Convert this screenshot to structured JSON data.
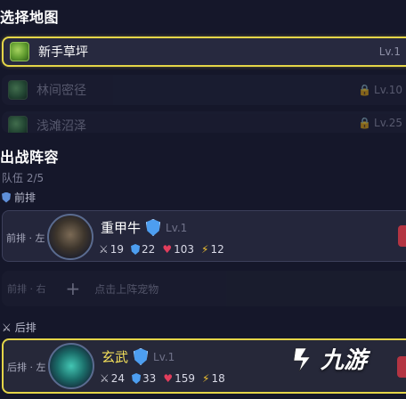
{
  "map_section": {
    "title": "选择地图",
    "maps": [
      {
        "name": "新手草坪",
        "level": "Lv.1",
        "locked": false,
        "selected": true
      },
      {
        "name": "林间密径",
        "level": "Lv.10",
        "locked": true,
        "selected": false
      },
      {
        "name": "浅滩沼泽",
        "level": "Lv.25",
        "locked": true,
        "selected": false
      }
    ]
  },
  "lineup": {
    "title": "出战阵容",
    "team_count": "队伍 2/5",
    "front_row_label": "前排",
    "back_row_label": "后排",
    "front_unit": {
      "slot": "前排 · 左",
      "name": "重甲牛",
      "level": "Lv.1",
      "attack": "19",
      "defense": "22",
      "hp": "103",
      "speed": "12"
    },
    "empty_slot": {
      "slot": "前排 · 右",
      "hint": "点击上阵宠物"
    },
    "back_unit": {
      "slot": "后排 · 左",
      "name": "玄武",
      "level": "Lv.1",
      "attack": "24",
      "defense": "33",
      "hp": "159",
      "speed": "18"
    }
  },
  "watermark": "九游",
  "colors": {
    "accent": "#e4d548",
    "background": "#15172a",
    "card": "#24263b"
  }
}
